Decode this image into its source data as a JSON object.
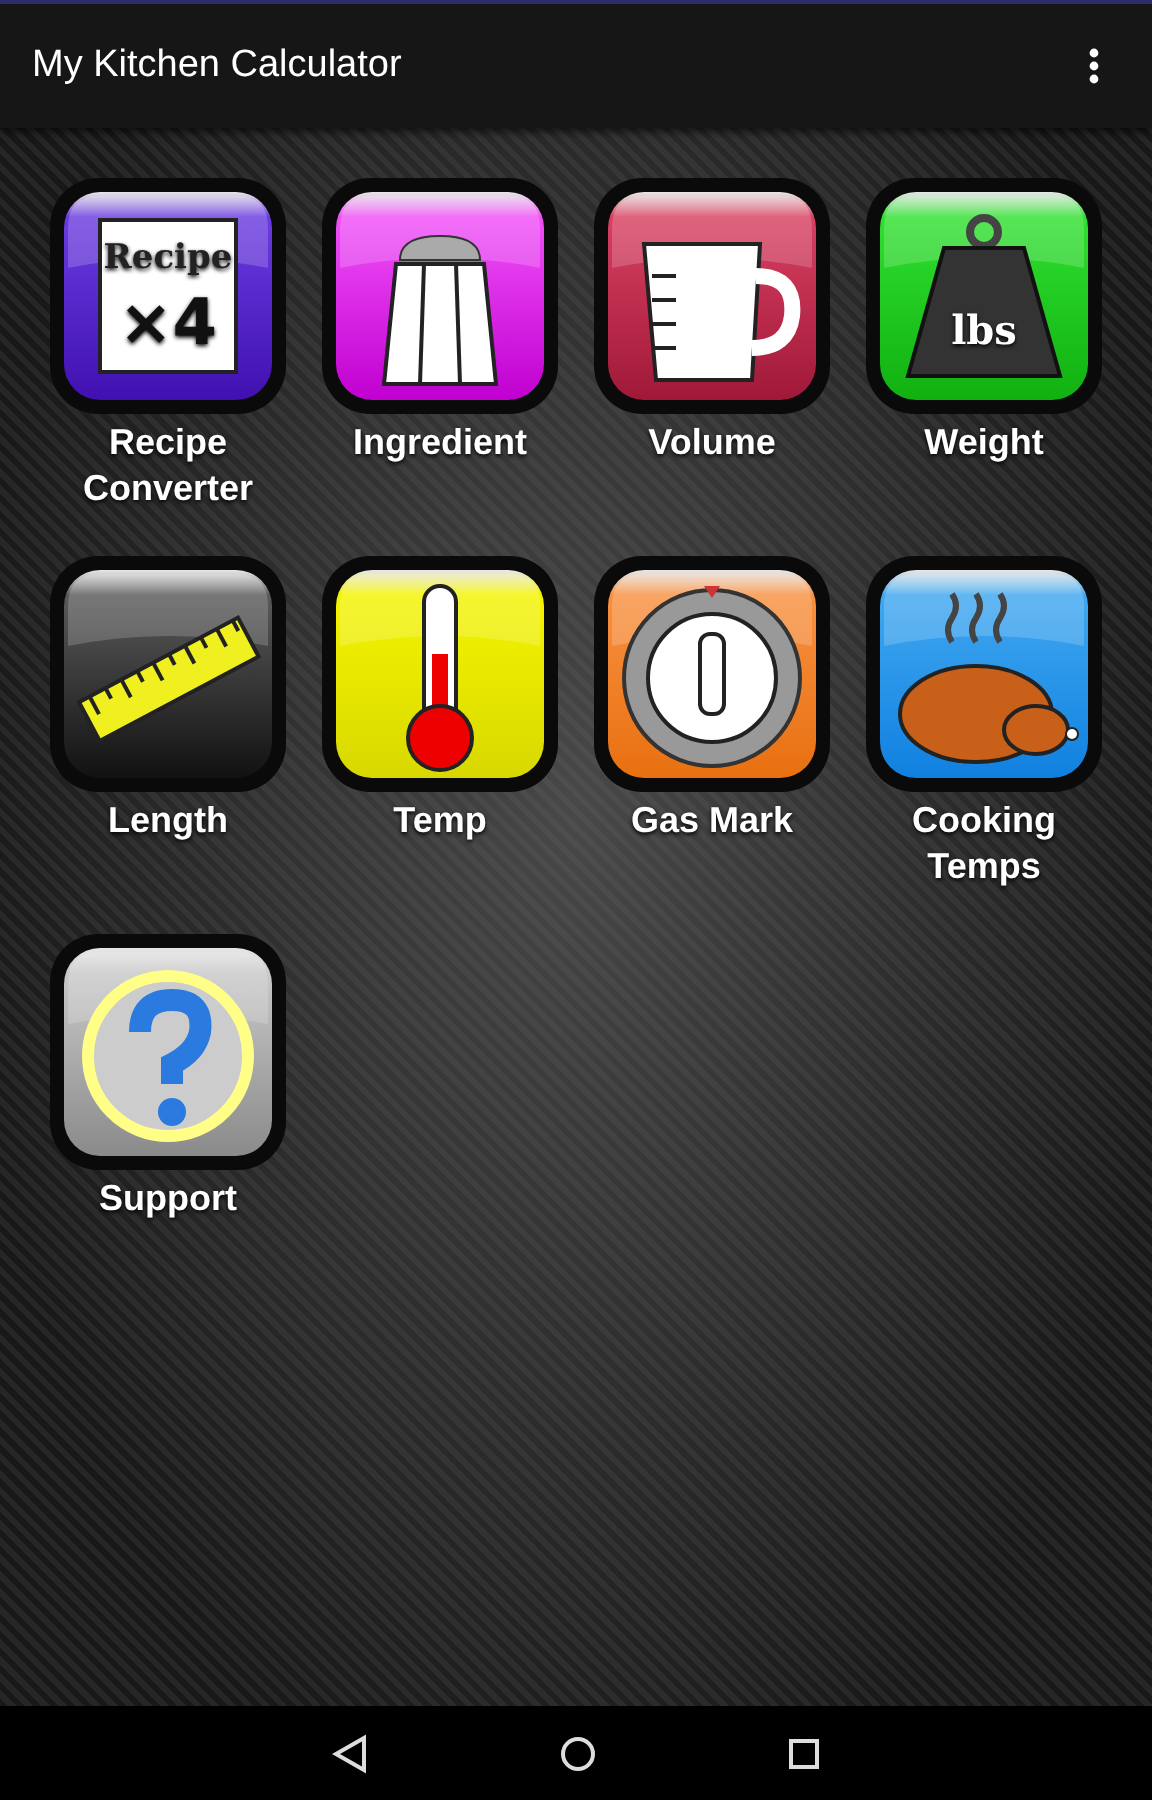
{
  "app_bar": {
    "title": "My Kitchen Calculator"
  },
  "tiles": [
    {
      "kind": "recipe",
      "label": "Recipe Converter",
      "icon_text": [
        "Recipe",
        "×4"
      ]
    },
    {
      "kind": "ingredient",
      "label": "Ingredient"
    },
    {
      "kind": "volume",
      "label": "Volume"
    },
    {
      "kind": "weight",
      "label": "Weight",
      "icon_text": [
        "lbs"
      ]
    },
    {
      "kind": "length",
      "label": "Length"
    },
    {
      "kind": "temp",
      "label": "Temp"
    },
    {
      "kind": "gas",
      "label": "Gas Mark"
    },
    {
      "kind": "cooking",
      "label": "Cooking Temps"
    },
    {
      "kind": "support",
      "label": "Support"
    }
  ]
}
